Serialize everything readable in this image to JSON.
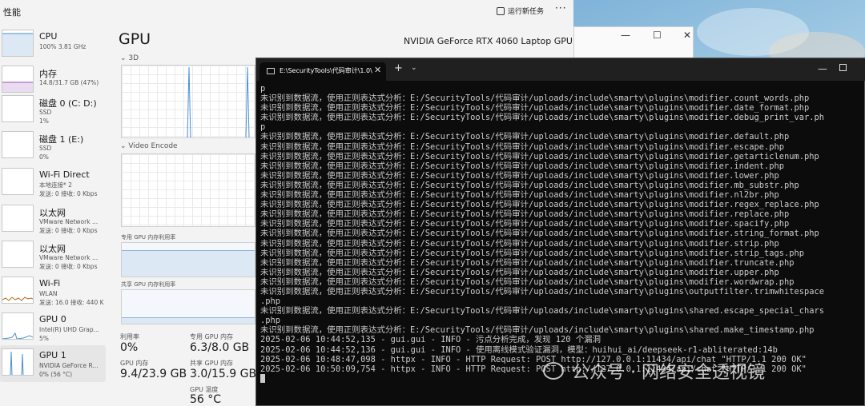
{
  "task_manager": {
    "title": "性能",
    "run_new_task": "运行新任务",
    "more": "···",
    "sidebar": [
      {
        "name": "CPU",
        "sub": "100%  3.81 GHz"
      },
      {
        "name": "内存",
        "sub": "14.8/31.7 GB (47%)"
      },
      {
        "name": "磁盘 0 (C: D:)",
        "sub": "SSD\n1%"
      },
      {
        "name": "磁盘 1 (E:)",
        "sub": "SSD\n0%"
      },
      {
        "name": "Wi-Fi Direct",
        "sub": "本地连接* 2\n发送: 0 接收: 0 Kbps"
      },
      {
        "name": "以太网",
        "sub": "VMware Network ...\n发送: 0 接收: 0 Kbps"
      },
      {
        "name": "以太网",
        "sub": "VMware Network ...\n发送: 0 接收: 0 Kbps"
      },
      {
        "name": "Wi-Fi",
        "sub": "WLAN\n发送: 16.0 接收: 440 K"
      },
      {
        "name": "GPU 0",
        "sub": "Intel(R) UHD Grap...\n5%"
      },
      {
        "name": "GPU 1",
        "sub": "NVIDIA GeForce R...\n0% (56 °C)"
      }
    ],
    "gpu": {
      "title": "GPU",
      "model": "NVIDIA GeForce RTX 4060 Laptop GPU",
      "section_3d": "3D",
      "section_video_encode": "Video Encode",
      "dedicated_mem_label": "专用 GPU 内存利用率",
      "shared_mem_label": "共享 GPU 内存利用率",
      "dedicated_fill": 0.79,
      "shared_fill": 0.19,
      "stats": {
        "utilization_label": "利用率",
        "utilization": "0%",
        "dedicated_label": "专用 GPU 内存",
        "dedicated": "6.3/8.0 GB",
        "gpu_mem_label": "GPU 内存",
        "gpu_mem": "9.4/23.9 GB",
        "shared_label": "共享 GPU 内存",
        "shared": "3.0/15.9 GB",
        "temp_label": "GPU 温度",
        "temp": "56 °C"
      }
    }
  },
  "behind_window": {
    "min": "—",
    "max": "☐",
    "close": "✕"
  },
  "terminal": {
    "tab_title": "E:\\SecurityTools\\代码审计\\1.0\\",
    "close": "✕",
    "add": "+",
    "dropdown": "⌄",
    "minimize": "—",
    "lines": [
      "p",
      "未识别到数据流，使用正则表达式分析：E:/SecurityTools/代码审计/uploads/include\\smarty\\plugins\\modifier.count_words.php",
      "未识别到数据流，使用正则表达式分析：E:/SecurityTools/代码审计/uploads/include\\smarty\\plugins\\modifier.date_format.php",
      "未识别到数据流，使用正则表达式分析：E:/SecurityTools/代码审计/uploads/include\\smarty\\plugins\\modifier.debug_print_var.ph",
      "p",
      "未识别到数据流，使用正则表达式分析：E:/SecurityTools/代码审计/uploads/include\\smarty\\plugins\\modifier.default.php",
      "未识别到数据流，使用正则表达式分析：E:/SecurityTools/代码审计/uploads/include\\smarty\\plugins\\modifier.escape.php",
      "未识别到数据流，使用正则表达式分析：E:/SecurityTools/代码审计/uploads/include\\smarty\\plugins\\modifier.getarticlenum.php",
      "未识别到数据流，使用正则表达式分析：E:/SecurityTools/代码审计/uploads/include\\smarty\\plugins\\modifier.indent.php",
      "未识别到数据流，使用正则表达式分析：E:/SecurityTools/代码审计/uploads/include\\smarty\\plugins\\modifier.lower.php",
      "未识别到数据流，使用正则表达式分析：E:/SecurityTools/代码审计/uploads/include\\smarty\\plugins\\modifier.mb_substr.php",
      "未识别到数据流，使用正则表达式分析：E:/SecurityTools/代码审计/uploads/include\\smarty\\plugins\\modifier.nl2br.php",
      "未识别到数据流，使用正则表达式分析：E:/SecurityTools/代码审计/uploads/include\\smarty\\plugins\\modifier.regex_replace.php",
      "未识别到数据流，使用正则表达式分析：E:/SecurityTools/代码审计/uploads/include\\smarty\\plugins\\modifier.replace.php",
      "未识别到数据流，使用正则表达式分析：E:/SecurityTools/代码审计/uploads/include\\smarty\\plugins\\modifier.spacify.php",
      "未识别到数据流，使用正则表达式分析：E:/SecurityTools/代码审计/uploads/include\\smarty\\plugins\\modifier.string_format.php",
      "未识别到数据流，使用正则表达式分析：E:/SecurityTools/代码审计/uploads/include\\smarty\\plugins\\modifier.strip.php",
      "未识别到数据流，使用正则表达式分析：E:/SecurityTools/代码审计/uploads/include\\smarty\\plugins\\modifier.strip_tags.php",
      "未识别到数据流，使用正则表达式分析：E:/SecurityTools/代码审计/uploads/include\\smarty\\plugins\\modifier.truncate.php",
      "未识别到数据流，使用正则表达式分析：E:/SecurityTools/代码审计/uploads/include\\smarty\\plugins\\modifier.upper.php",
      "未识别到数据流，使用正则表达式分析：E:/SecurityTools/代码审计/uploads/include\\smarty\\plugins\\modifier.wordwrap.php",
      "未识别到数据流，使用正则表达式分析：E:/SecurityTools/代码审计/uploads/include\\smarty\\plugins\\outputfilter.trimwhitespace",
      ".php",
      "未识别到数据流，使用正则表达式分析：E:/SecurityTools/代码审计/uploads/include\\smarty\\plugins\\shared.escape_special_chars",
      ".php",
      "未识别到数据流，使用正则表达式分析：E:/SecurityTools/代码审计/uploads/include\\smarty\\plugins\\shared.make_timestamp.php",
      "2025-02-06 10:44:52,135 - gui.gui - INFO - 污点分析完成，发现 120 个漏洞",
      "2025-02-06 10:44:52,136 - gui.gui - INFO - 使用离线模式验证漏洞，模型：huihui_ai/deepseek-r1-abliterated:14b",
      "2025-02-06 10:48:47,098 - httpx - INFO - HTTP Request: POST http://127.0.0.1:11434/api/chat \"HTTP/1.1 200 OK\"",
      "2025-02-06 10:50:09,754 - httpx - INFO - HTTP Request: POST http://127.0.0.1:11434/api/chat \"HTTP/1.1 200 OK\""
    ]
  },
  "watermark": "公众号 · 网络安全透视镜"
}
